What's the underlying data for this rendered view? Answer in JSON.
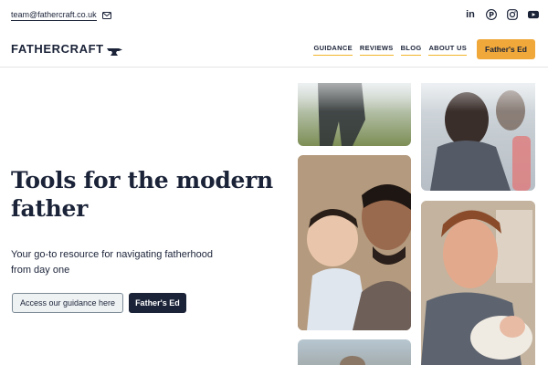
{
  "topbar": {
    "email": "team@fathercraft.co.uk",
    "icons": [
      "mail-icon",
      "linkedin-icon",
      "pinterest-icon",
      "instagram-icon",
      "youtube-icon"
    ],
    "linkedin_glyph": "in",
    "pinterest_glyph": "P"
  },
  "brand": {
    "name": "FATHERCRAFT",
    "icon": "anvil-icon"
  },
  "nav": {
    "items": [
      {
        "label": "GUIDANCE"
      },
      {
        "label": "REVIEWS"
      },
      {
        "label": "BLOG"
      },
      {
        "label": "ABOUT US"
      }
    ],
    "cta_label": "Father's Ed"
  },
  "hero": {
    "title": "Tools for the modern father",
    "subtitle": "Your go-to resource for navigating fatherhood from day one",
    "primary_button": "Access our guidance here",
    "secondary_button": "Father's Ed"
  },
  "colors": {
    "navy": "#1b2338",
    "accent": "#f0a83a",
    "underline": "#f0b429"
  }
}
